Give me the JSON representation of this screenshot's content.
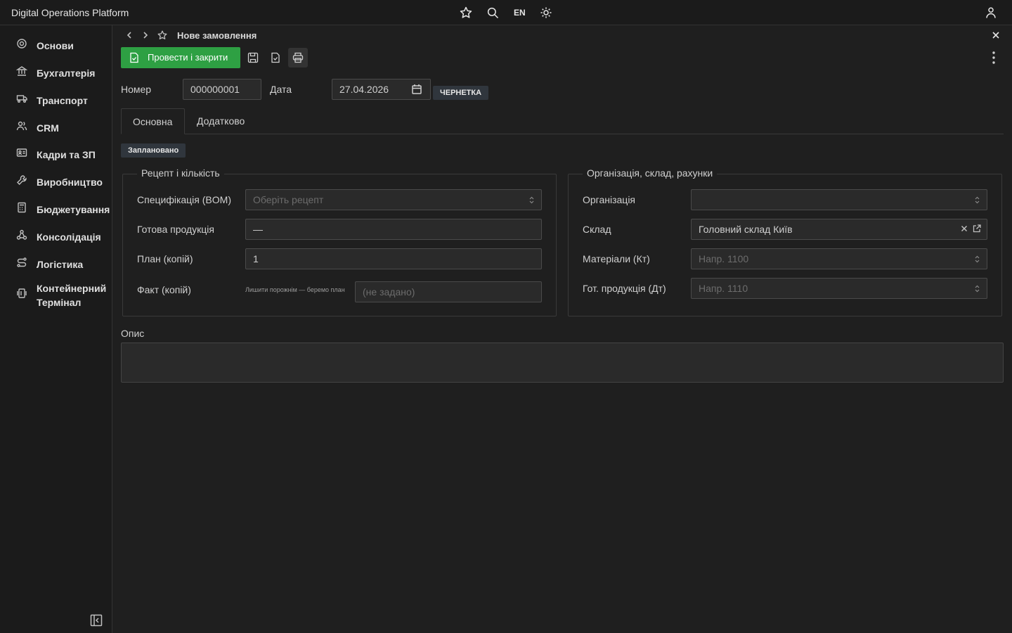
{
  "app": {
    "title": "Digital Operations Platform",
    "lang": "EN"
  },
  "sidebar": {
    "items": [
      {
        "label": "Основи",
        "icon": "target-icon"
      },
      {
        "label": "Бухгалтерія",
        "icon": "bank-icon"
      },
      {
        "label": "Транспорт",
        "icon": "truck-icon"
      },
      {
        "label": "CRM",
        "icon": "users-icon"
      },
      {
        "label": "Кадри та ЗП",
        "icon": "id-card-icon"
      },
      {
        "label": "Виробництво",
        "icon": "wrench-icon"
      },
      {
        "label": "Бюджетування",
        "icon": "calculator-icon"
      },
      {
        "label": "Консолідація",
        "icon": "hierarchy-icon"
      },
      {
        "label": "Логістика",
        "icon": "route-icon"
      },
      {
        "label": "Контейнерний Термінал",
        "icon": "container-icon"
      }
    ]
  },
  "document": {
    "title": "Нове замовлення",
    "primary_action": "Провести і закрити",
    "number_label": "Номер",
    "number_value": "000000001",
    "date_label": "Дата",
    "date_value": "27.04.2026",
    "status_badge": "ЧЕРНЕТКА"
  },
  "tabs": [
    {
      "label": "Основна"
    },
    {
      "label": "Додатково"
    }
  ],
  "state_badge": "Заплановано",
  "recipe_section": {
    "legend": "Рецепт і кількість",
    "bom_label": "Специфікація (BOM)",
    "bom_placeholder": "Оберіть рецепт",
    "product_label": "Готова продукція",
    "product_value": "—",
    "plan_label": "План (копій)",
    "plan_value": "1",
    "fact_label": "Факт (копій)",
    "fact_hint": "Лишити порожнім — беремо план",
    "fact_placeholder": "(не задано)"
  },
  "org_section": {
    "legend": "Організація, склад, рахунки",
    "org_label": "Організація",
    "org_value": "",
    "warehouse_label": "Склад",
    "warehouse_value": "Головний склад Київ",
    "materials_label": "Матеріали (Кт)",
    "materials_placeholder": "Напр. 1100",
    "finished_label": "Гот. продукція (Дт)",
    "finished_placeholder": "Напр. 1110"
  },
  "description": {
    "label": "Опис",
    "value": ""
  },
  "colors": {
    "accent": "#2ea043",
    "background": "#1f1f1f",
    "panel": "#1b1b1b",
    "input": "#2a2a2a"
  }
}
